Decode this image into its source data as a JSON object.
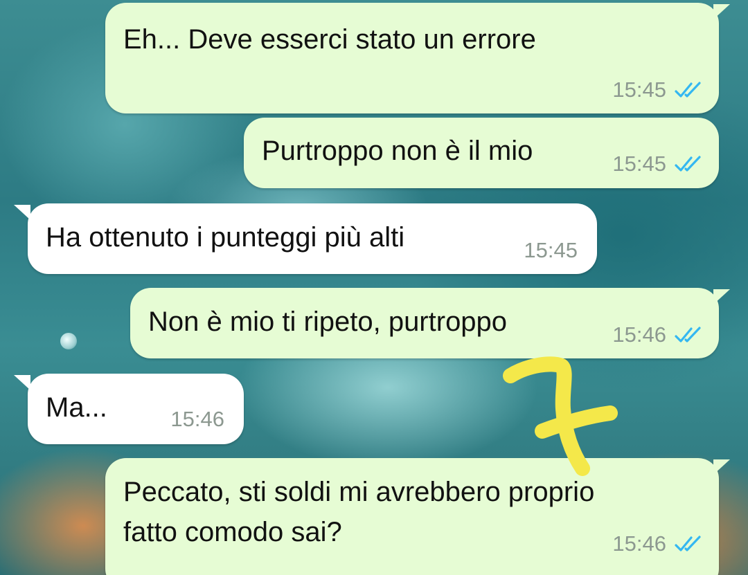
{
  "colors": {
    "outgoing_bubble": "#e6fcd4",
    "incoming_bubble": "#ffffff",
    "read_ticks": "#34b7f1",
    "timestamp": "#8c9890",
    "annotation_scribble": "#f4e84a"
  },
  "messages": [
    {
      "direction": "outgoing",
      "text": "Eh... Deve esserci stato un errore",
      "time": "15:45",
      "status": "read",
      "status_icon": "double-check-icon"
    },
    {
      "direction": "outgoing",
      "text": "Purtroppo non è il mio",
      "time": "15:45",
      "status": "read",
      "status_icon": "double-check-icon"
    },
    {
      "direction": "incoming",
      "text": "Ha ottenuto i punteggi più alti",
      "time": "15:45"
    },
    {
      "direction": "outgoing",
      "text": "Non è mio ti ripeto, purtroppo",
      "time": "15:46",
      "status": "read",
      "status_icon": "double-check-icon"
    },
    {
      "direction": "incoming",
      "text": "Ma...",
      "time": "15:46"
    },
    {
      "direction": "outgoing",
      "text_lines": [
        "Peccato, sti soldi mi avrebbero proprio",
        "fatto comodo sai?"
      ],
      "time": "15:46",
      "status": "read",
      "status_icon": "double-check-icon"
    }
  ]
}
